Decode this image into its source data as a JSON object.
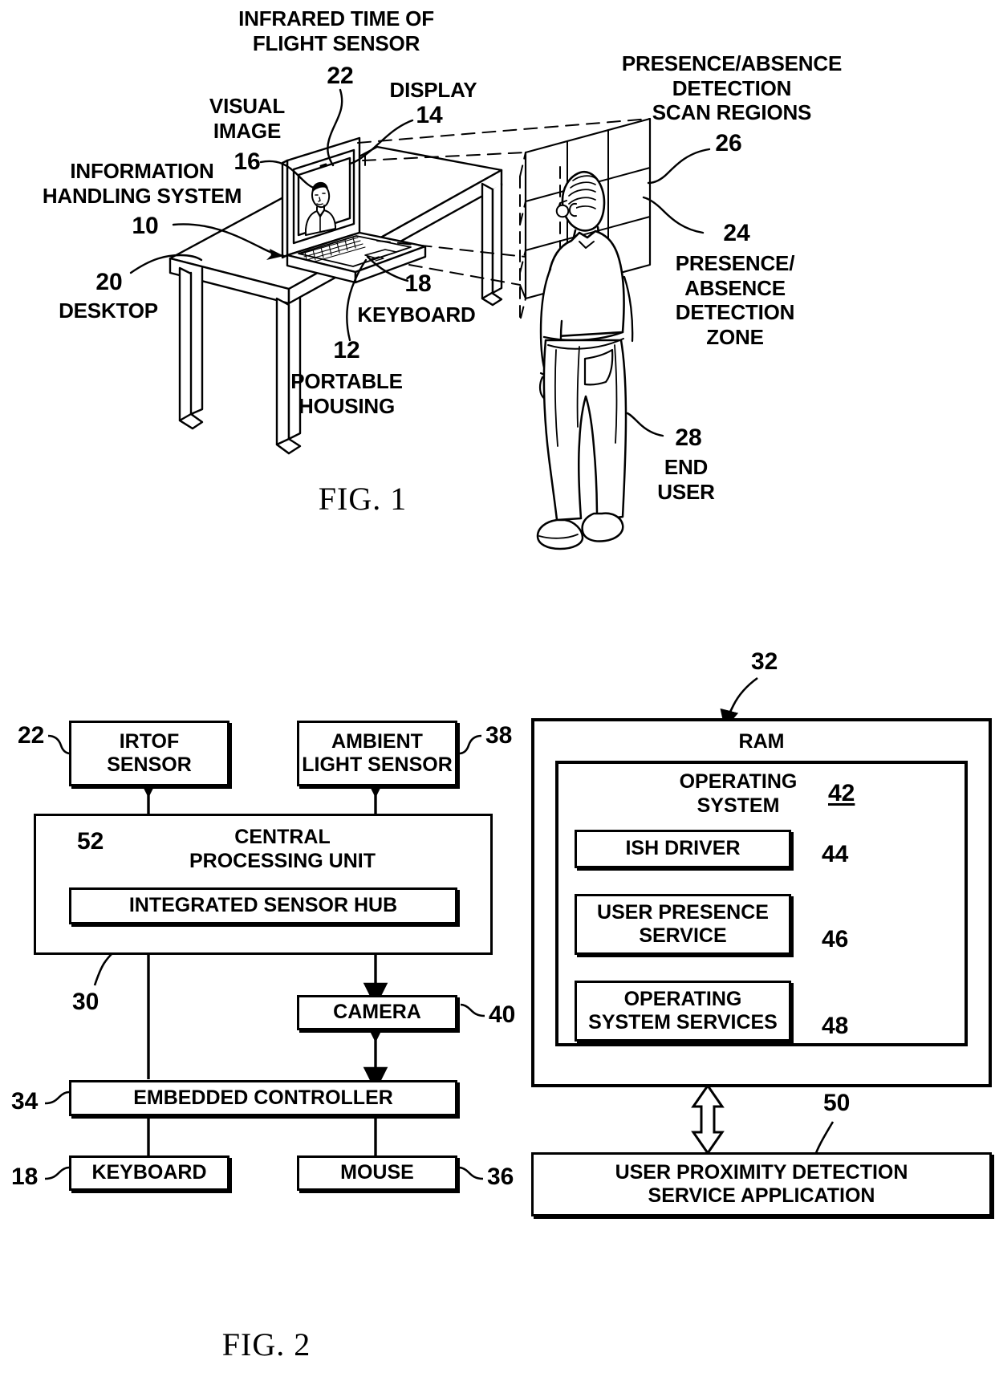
{
  "document": {
    "type": "patent-drawing-sheet",
    "figures": [
      "FIG. 1",
      "FIG. 2"
    ]
  },
  "fig1": {
    "title": "FIG. 1",
    "labels": {
      "irtof": "INFRARED TIME OF\nFLIGHT SENSOR",
      "irtof_num": "22",
      "display": "DISPLAY",
      "display_num": "14",
      "visual_image": "VISUAL\nIMAGE",
      "visual_image_num": "16",
      "information_handling_system": "INFORMATION\nHANDLING SYSTEM",
      "information_handling_system_num": "10",
      "desktop_num": "20",
      "desktop": "DESKTOP",
      "portable_housing_num": "12",
      "portable_housing": "PORTABLE\nHOUSING",
      "keyboard_num": "18",
      "keyboard": "KEYBOARD",
      "scan_regions": "PRESENCE/ABSENCE\nDETECTION\nSCAN REGIONS",
      "scan_regions_num": "26",
      "detection_zone_num": "24",
      "detection_zone": "PRESENCE/\nABSENCE\nDETECTION\nZONE",
      "end_user_num": "28",
      "end_user": "END\nUSER"
    }
  },
  "fig2": {
    "title": "FIG. 2",
    "blocks": {
      "irtof_sensor": {
        "label": "IRTOF\nSENSOR",
        "ref": "22"
      },
      "ambient_light_sensor": {
        "label": "AMBIENT\nLIGHT SENSOR",
        "ref": "38"
      },
      "cpu": {
        "label": "CENTRAL\nPROCESSING UNIT",
        "ref": "30"
      },
      "integrated_sensor_hub": {
        "label": "INTEGRATED SENSOR HUB",
        "ref": "52"
      },
      "camera": {
        "label": "CAMERA",
        "ref": "40"
      },
      "embedded_controller": {
        "label": "EMBEDDED CONTROLLER",
        "ref": "34"
      },
      "keyboard": {
        "label": "KEYBOARD",
        "ref": "18"
      },
      "mouse": {
        "label": "MOUSE",
        "ref": "36"
      },
      "ram": {
        "label": "RAM",
        "ref": "32"
      },
      "operating_system": {
        "label": "OPERATING\nSYSTEM",
        "ref": "42"
      },
      "ish_driver": {
        "label": "ISH DRIVER",
        "ref": "44"
      },
      "user_presence_service": {
        "label": "USER PRESENCE\nSERVICE",
        "ref": "46"
      },
      "operating_system_services": {
        "label": "OPERATING\nSYSTEM SERVICES",
        "ref": "48"
      },
      "user_proximity_detection_service_application": {
        "label": "USER PROXIMITY DETECTION\nSERVICE APPLICATION",
        "ref": "50"
      }
    }
  },
  "colors": {
    "ink": "#000000",
    "paper": "#ffffff"
  }
}
